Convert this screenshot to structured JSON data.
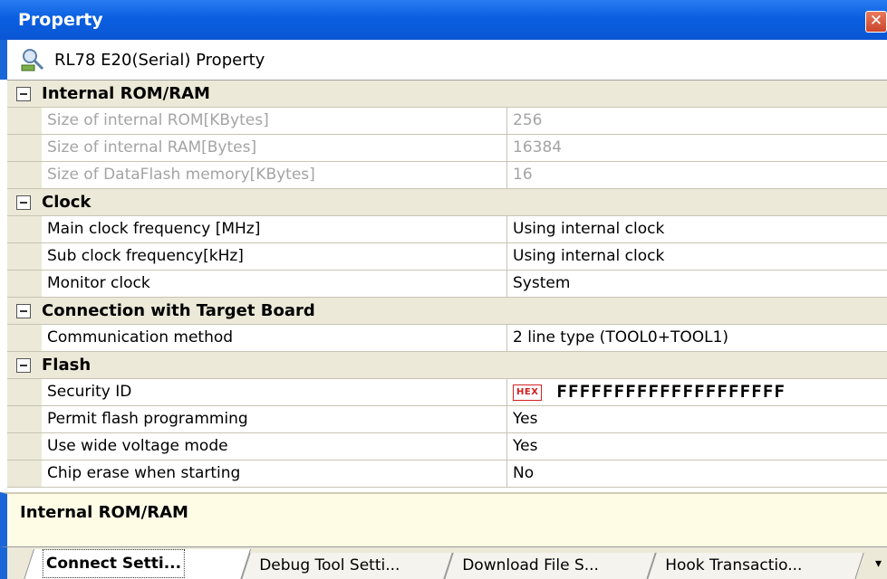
{
  "window": {
    "title": "Property",
    "close_glyph": "✕"
  },
  "header": {
    "icon": "debugger-tool-icon",
    "text": "RL78 E20(Serial) Property"
  },
  "categories": [
    {
      "label": "Internal ROM/RAM",
      "rows": [
        {
          "name": "Size of internal ROM[KBytes]",
          "value": "256",
          "disabled": true
        },
        {
          "name": "Size of internal RAM[Bytes]",
          "value": "16384",
          "disabled": true
        },
        {
          "name": "Size of DataFlash memory[KBytes]",
          "value": "16",
          "disabled": true
        }
      ]
    },
    {
      "label": "Clock",
      "rows": [
        {
          "name": "Main clock frequency [MHz]",
          "value": "Using internal clock"
        },
        {
          "name": "Sub clock frequency[kHz]",
          "value": "Using internal clock"
        },
        {
          "name": "Monitor clock",
          "value": "System"
        }
      ]
    },
    {
      "label": "Connection with Target Board",
      "rows": [
        {
          "name": "Communication method",
          "value": "2 line type (TOOL0+TOOL1)"
        }
      ]
    },
    {
      "label": "Flash",
      "rows": [
        {
          "name": "Security ID",
          "value": "FFFFFFFFFFFFFFFFFFFF",
          "hex_badge": "HEX"
        },
        {
          "name": "Permit flash programming",
          "value": "Yes"
        },
        {
          "name": "Use wide voltage mode",
          "value": "Yes"
        },
        {
          "name": "Chip erase when starting",
          "value": "No"
        }
      ]
    }
  ],
  "description": {
    "text": "Internal ROM/RAM"
  },
  "tabs": [
    {
      "label": "Connect Setti...",
      "active": true
    },
    {
      "label": "Debug Tool Setti..."
    },
    {
      "label": "Download File S..."
    },
    {
      "label": "Hook Transactio..."
    }
  ],
  "tab_menu_glyph": "▾",
  "colors": {
    "title_bar": "#0a5fe0",
    "category_bg": "#ece9d8",
    "description_bg": "#fffce6",
    "disabled_text": "#a4a4a4",
    "hex_badge": "#d42020"
  }
}
